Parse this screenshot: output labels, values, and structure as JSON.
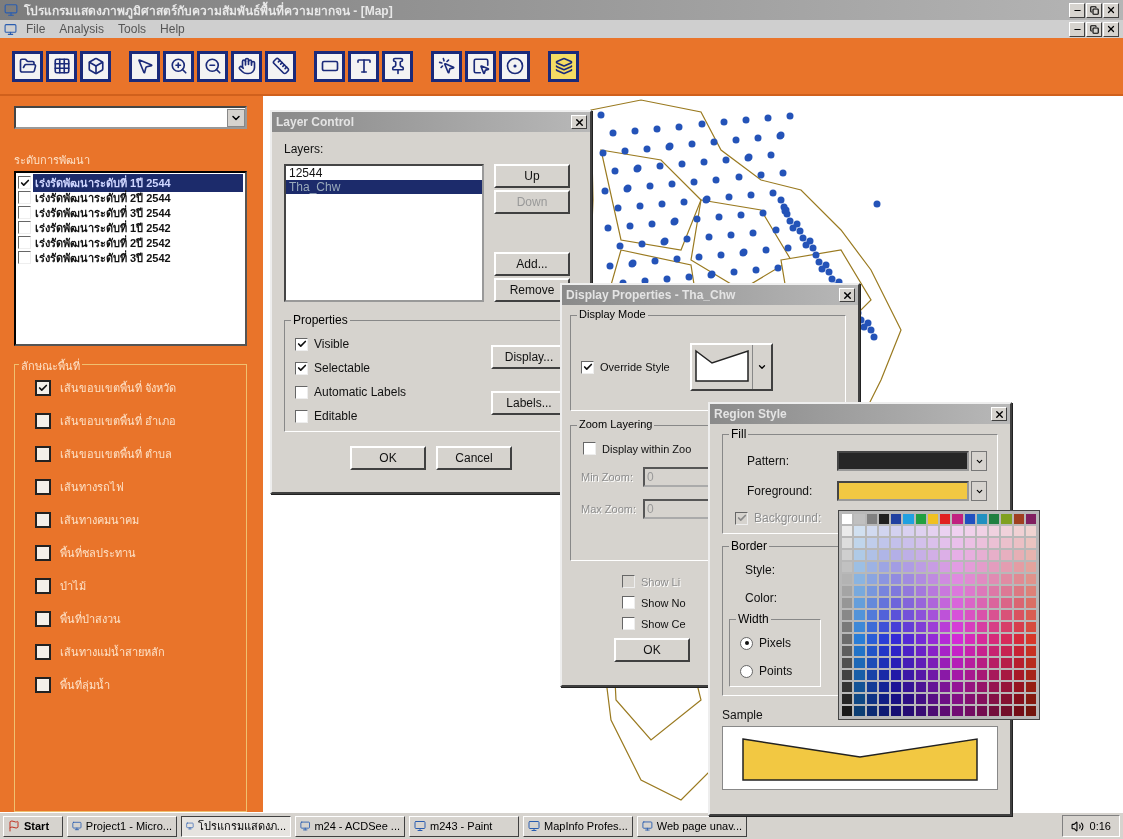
{
  "window": {
    "title": "โปรแกรมแสดงภาพภูมิศาสตร์กับความสัมพันธ์พื้นที่ความยากจน - [Map]",
    "menu": [
      "File",
      "Analysis",
      "Tools",
      "Help"
    ]
  },
  "toolbar": [
    [
      {
        "kind": "open",
        "selected": false
      },
      {
        "kind": "table",
        "selected": false
      },
      {
        "kind": "box",
        "selected": false
      }
    ],
    [
      {
        "kind": "select",
        "selected": false
      },
      {
        "kind": "zoomin",
        "selected": false
      },
      {
        "kind": "zoomout",
        "selected": false
      },
      {
        "kind": "pan",
        "selected": false
      },
      {
        "kind": "ruler",
        "selected": false
      }
    ],
    [
      {
        "kind": "label",
        "selected": false
      },
      {
        "kind": "text",
        "selected": false
      },
      {
        "kind": "pin",
        "selected": false
      }
    ],
    [
      {
        "kind": "click",
        "selected": false
      },
      {
        "kind": "rectselect",
        "selected": false
      },
      {
        "kind": "radiusselect",
        "selected": false
      }
    ],
    [
      {
        "kind": "layers",
        "selected": true
      }
    ]
  ],
  "sidebar": {
    "levels_title": "ระดับการพัฒนา",
    "levels": [
      {
        "label": "เร่งรัดพัฒนาระดับที่ 1ปี 2544",
        "checked": true,
        "selected": true
      },
      {
        "label": "เร่งรัดพัฒนาระดับที่ 2ปี 2544",
        "checked": false,
        "selected": false
      },
      {
        "label": "เร่งรัดพัฒนาระดับที่ 3ปี 2544",
        "checked": false,
        "selected": false
      },
      {
        "label": "เร่งรัดพัฒนาระดับที่ 1ปี 2542",
        "checked": false,
        "selected": false
      },
      {
        "label": "เร่งรัดพัฒนาระดับที่ 2ปี 2542",
        "checked": false,
        "selected": false
      },
      {
        "label": "เร่งรัดพัฒนาระดับที่ 3ปี 2542",
        "checked": false,
        "selected": false
      }
    ],
    "features_title": "ลักษณะพื้นที่",
    "features": [
      {
        "label": "เส้นขอบเขตพื้นที่ จังหวัด",
        "checked": true
      },
      {
        "label": "เส้นขอบเขตพื้นที่ อำเภอ",
        "checked": false
      },
      {
        "label": "เส้นขอบเขตพื้นที่ ตำบล",
        "checked": false
      },
      {
        "label": "เส้นทางรถไฟ",
        "checked": false
      },
      {
        "label": "เส้นทางคมนาคม",
        "checked": false
      },
      {
        "label": "พื้นที่ชลประทาน",
        "checked": false
      },
      {
        "label": "ป่าไม้",
        "checked": false
      },
      {
        "label": "พื้นที่ป่าสงวน",
        "checked": false
      },
      {
        "label": "เส้นทางแม่น้ำสายหลัก",
        "checked": false
      },
      {
        "label": "พื้นที่ลุ่มน้ำ",
        "checked": false
      }
    ]
  },
  "layer_control": {
    "title": "Layer Control",
    "layers_label": "Layers:",
    "layers": [
      {
        "name": "12544",
        "selected": false
      },
      {
        "name": "Tha_Chw",
        "selected": true
      }
    ],
    "buttons": [
      {
        "label": "Up",
        "disabled": false
      },
      {
        "label": "Down",
        "disabled": true
      },
      {
        "label": "Add...",
        "disabled": false
      },
      {
        "label": "Remove",
        "disabled": false
      }
    ],
    "properties_label": "Properties",
    "properties": [
      {
        "label": "Visible",
        "checked": true
      },
      {
        "label": "Selectable",
        "checked": true
      },
      {
        "label": "Automatic Labels",
        "checked": false
      },
      {
        "label": "Editable",
        "checked": false
      }
    ],
    "side_buttons": [
      "Display...",
      "Labels..."
    ],
    "footer_buttons": [
      "OK",
      "Cancel"
    ]
  },
  "display_properties": {
    "title": "Display Properties - Tha_Chw",
    "mode_label": "Display Mode",
    "override": {
      "label": "Override Style",
      "checked": true
    },
    "zoom_label": "Zoom Layering",
    "zoom_check": {
      "label": "Display within Zoo",
      "checked": false
    },
    "min_zoom": {
      "label": "Min Zoom:",
      "value": "0"
    },
    "max_zoom": {
      "label": "Max Zoom:",
      "value": "0"
    },
    "options": [
      {
        "label": "Show Li",
        "checked": false,
        "disabled": true
      },
      {
        "label": "Show No",
        "checked": false,
        "disabled": false
      },
      {
        "label": "Show Ce",
        "checked": false,
        "disabled": false
      }
    ],
    "ok": "OK"
  },
  "region_style": {
    "title": "Region Style",
    "fill_label": "Fill",
    "pattern_label": "Pattern:",
    "foreground_label": "Foreground:",
    "background": {
      "label": "Background:",
      "checked": true,
      "disabled": true
    },
    "border_label": "Border",
    "style_label": "Style:",
    "color_label": "Color:",
    "width_label": "Width",
    "units": [
      {
        "label": "Pixels",
        "selected": true
      },
      {
        "label": "Points",
        "selected": false
      }
    ],
    "sample_label": "Sample"
  },
  "taskbar": {
    "start": "Start",
    "tasks": [
      {
        "label": "Project1 - Micro...",
        "selected": false
      },
      {
        "label": "โปรแกรมแสดงภ...",
        "selected": true
      },
      {
        "label": "m24 - ACDSee ...",
        "selected": false
      },
      {
        "label": "m243 - Paint",
        "selected": false
      },
      {
        "label": "MapInfo Profes...",
        "selected": false
      },
      {
        "label": "Web page unav...",
        "selected": false
      }
    ],
    "clock": "0:16"
  }
}
